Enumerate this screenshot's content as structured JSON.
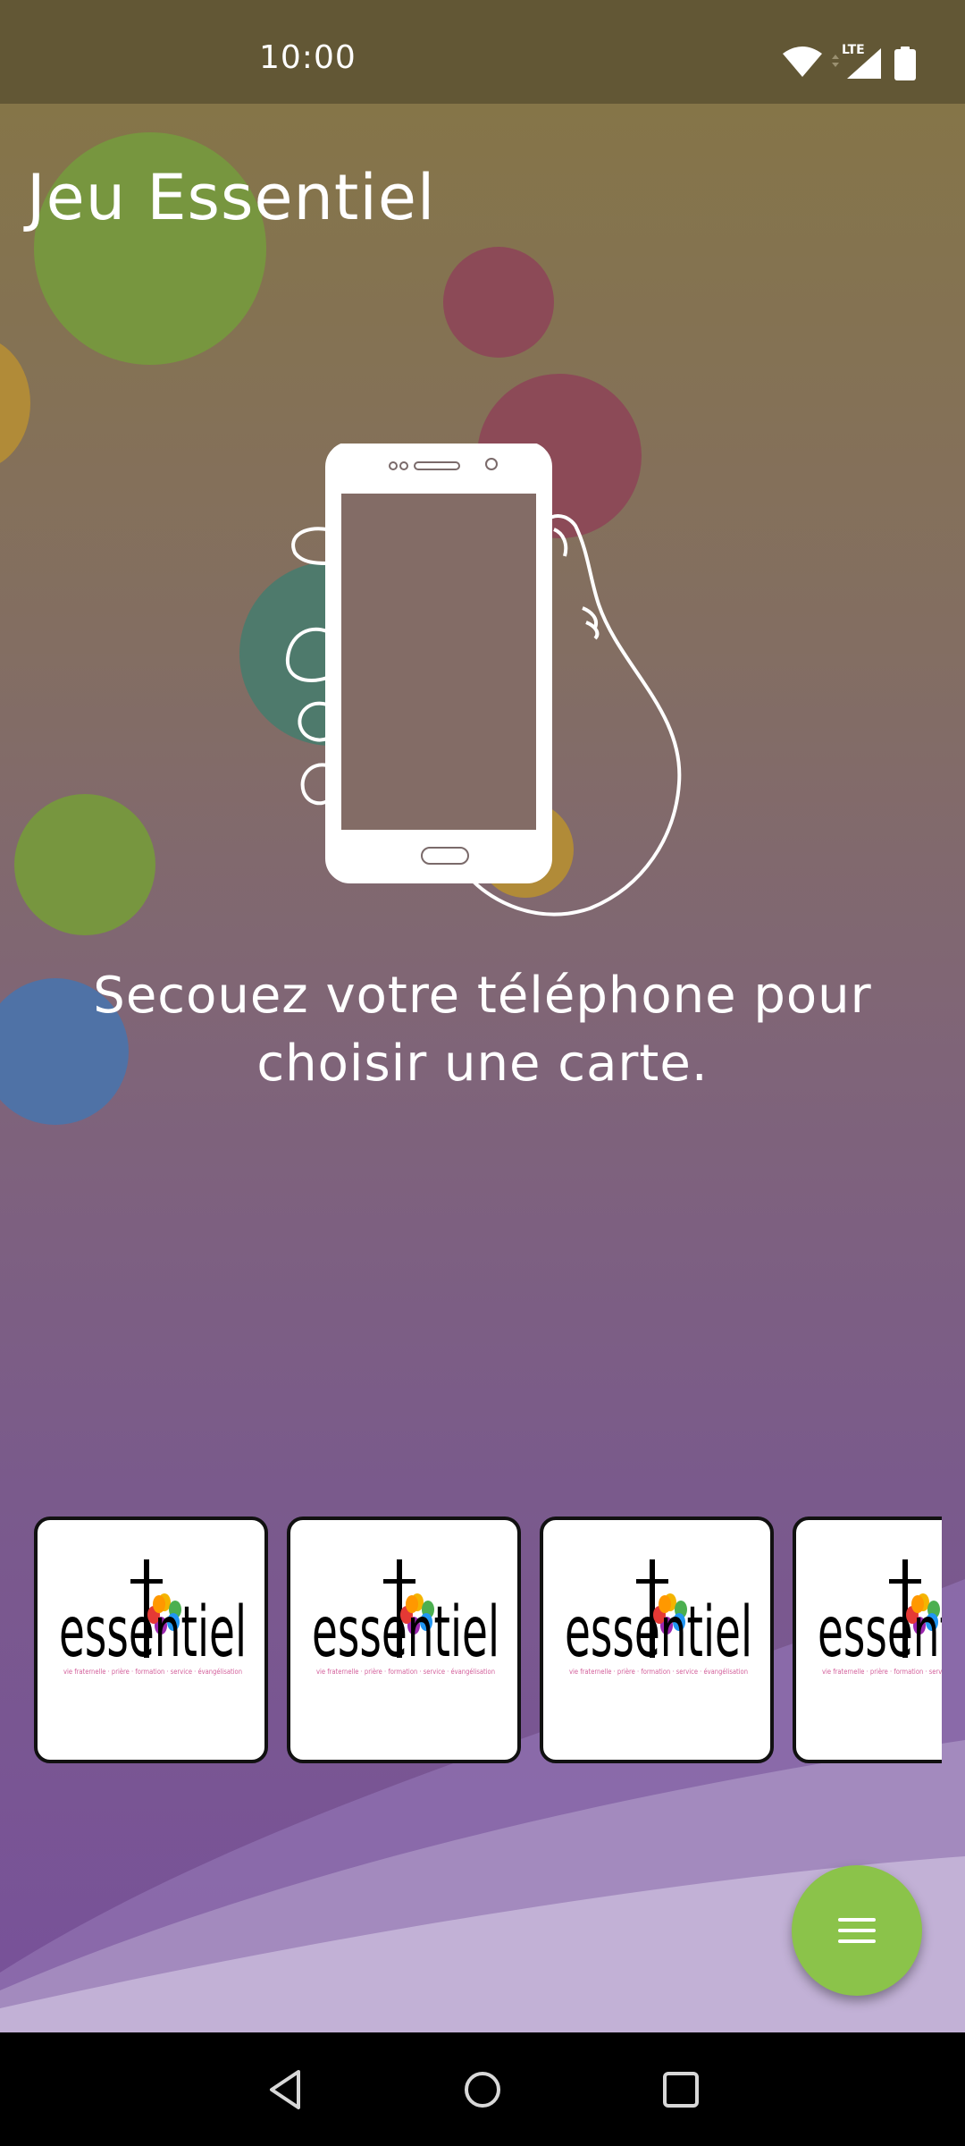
{
  "status_bar": {
    "time": "10:00",
    "network_label": "LTE",
    "icons": [
      "wifi-icon",
      "lte-signal-icon",
      "battery-icon"
    ]
  },
  "app": {
    "title": "Jeu Essentiel",
    "instruction": "Secouez votre téléphone pour choisir une carte.",
    "illustration": "hand-holding-phone-icon"
  },
  "cards": {
    "items": [
      {
        "logo_text": "essentiel",
        "tagline": "vie fraternelle · prière · formation · service · évangélisation"
      },
      {
        "logo_text": "essentiel",
        "tagline": "vie fraternelle · prière · formation · service · évangélisation"
      },
      {
        "logo_text": "essentiel",
        "tagline": "vie fraternelle · prière · formation · service · évangélisation"
      },
      {
        "logo_text": "essentiel",
        "tagline": "vie fraternelle · prière · formation · service · évangélisation"
      }
    ]
  },
  "fab": {
    "icon": "menu-icon",
    "color": "#8bc34a"
  },
  "nav_bar": {
    "buttons": [
      "back-icon",
      "home-icon",
      "recents-icon"
    ]
  },
  "colors": {
    "status_bar": "#625735",
    "gradient_top": "#857548",
    "gradient_bottom": "#78519a",
    "bubble_green": "#77963f",
    "bubble_red": "#8c4a57",
    "bubble_teal": "#4e7a6c",
    "bubble_yellow": "#b18b38",
    "bubble_blue": "#4f72a6",
    "wave_light": "#c2b1d6"
  }
}
